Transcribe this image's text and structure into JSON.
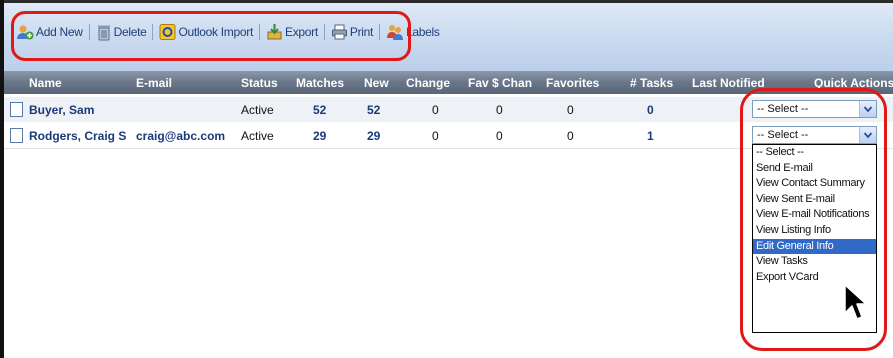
{
  "toolbar": {
    "add_new": "Add New",
    "delete": "Delete",
    "outlook_import": "Outlook Import",
    "export": "Export",
    "print": "Print",
    "labels": "Labels"
  },
  "table": {
    "headers": [
      "Name",
      "E-mail",
      "Status",
      "Matches",
      "New",
      "Change",
      "Fav $ Change",
      "Favorites",
      "# Tasks",
      "Last Notified",
      "Quick Actions"
    ],
    "rows": [
      {
        "name": "Buyer, Sam",
        "email": "",
        "status": "Active",
        "matches": "52",
        "new": "52",
        "change": "0",
        "fav_change": "0",
        "favorites": "0",
        "tasks": "0",
        "last_notified": "",
        "quick_action": "-- Select --"
      },
      {
        "name": "Rodgers, Craig S",
        "email": "craig@abc.com",
        "status": "Active",
        "matches": "29",
        "new": "29",
        "change": "0",
        "fav_change": "0",
        "favorites": "0",
        "tasks": "1",
        "last_notified": "",
        "quick_action": "-- Select --"
      }
    ]
  },
  "quick_actions_dropdown": {
    "options": [
      "-- Select --",
      "Send E-mail",
      "View Contact Summary",
      "View Sent E-mail",
      "View E-mail Notifications",
      "View Listing Info",
      "Edit General Info",
      "View Tasks",
      "Export VCard"
    ],
    "highlighted": "Edit General Info"
  },
  "colors": {
    "accent": "#1b3a7a",
    "annotation": "#e01818",
    "selection": "#3169c6"
  }
}
